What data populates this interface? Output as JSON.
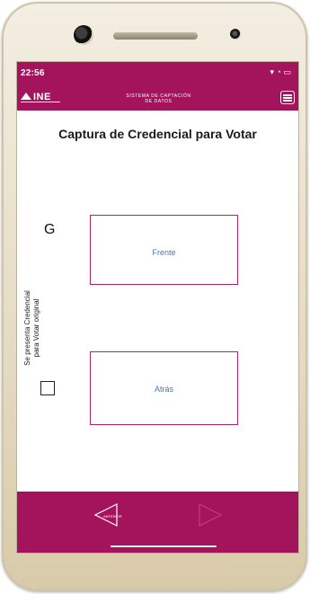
{
  "status": {
    "time": "22:56",
    "icons": "▾ ◔ ▭"
  },
  "header": {
    "logo_text": "INE",
    "app_title_line1": "SISTEMA DE CAPTACIÓN",
    "app_title_line2": "DE DATOS"
  },
  "main": {
    "title": "Captura de Credencial para Votar",
    "letter": "G",
    "front_label": "Frente",
    "back_label": "Atrás",
    "vertical_label": "Se presenta Credencial para Votar original",
    "checkbox_checked": false
  },
  "nav": {
    "prev_label": "ANTERIOR"
  },
  "colors": {
    "brand": "#a3145d",
    "link": "#3b79c7",
    "next_disabled": "#c63a79"
  }
}
